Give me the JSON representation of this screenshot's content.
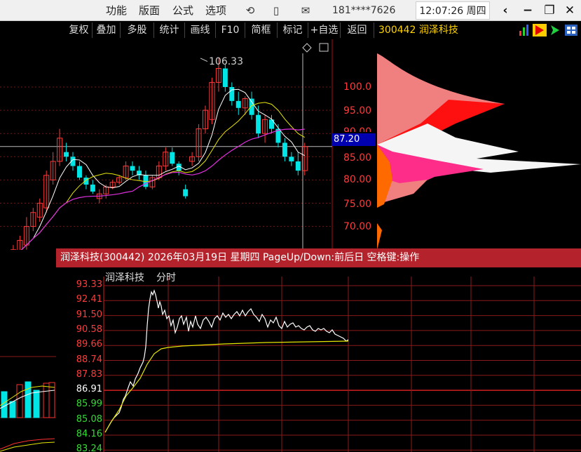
{
  "titlebar": {
    "menus": [
      "功能",
      "版面",
      "公式",
      "选项"
    ],
    "phone": "181****7626",
    "clock": "12:07:26 周四",
    "icons": [
      "refresh-icon",
      "phone-icon",
      "mail-icon"
    ],
    "window_buttons": [
      "‹",
      "−",
      "❐",
      "✕"
    ]
  },
  "toolbar": {
    "buttons": [
      "复权",
      "叠加",
      "多股",
      "统计",
      "画线",
      "F10",
      "简框",
      "标记",
      "+自选",
      "返回"
    ],
    "stock": "300442 润泽科技"
  },
  "kchart": {
    "peak_label": "106.33",
    "price_labels": [
      "100.0",
      "95.00",
      "90.00",
      "85.00",
      "80.00",
      "75.00",
      "70.00"
    ],
    "current_price": "87.20",
    "colors": {
      "up": "#ff3a3a",
      "down": "#00e5e5",
      "ma5": "#ffffff",
      "ma10": "#e5e500",
      "ma20": "#e030e0"
    }
  },
  "popup": {
    "title": "润泽科技(300442) 2026年03月19日 星期四 PageUp/Down:前后日 空格键:操作",
    "subtitle_name": "润泽科技",
    "subtitle_mode": "分时",
    "price_labels": [
      {
        "text": "93.33",
        "color": "#ff3b3b"
      },
      {
        "text": "92.41",
        "color": "#ff3b3b"
      },
      {
        "text": "91.50",
        "color": "#ff3b3b"
      },
      {
        "text": "90.58",
        "color": "#ff3b3b"
      },
      {
        "text": "89.66",
        "color": "#ff3b3b"
      },
      {
        "text": "88.74",
        "color": "#ff3b3b"
      },
      {
        "text": "87.83",
        "color": "#ff3b3b"
      },
      {
        "text": "86.91",
        "color": "#ffffff"
      },
      {
        "text": "85.99",
        "color": "#33dd33"
      },
      {
        "text": "85.08",
        "color": "#33dd33"
      },
      {
        "text": "84.16",
        "color": "#33dd33"
      },
      {
        "text": "83.24",
        "color": "#33dd33"
      }
    ]
  }
}
